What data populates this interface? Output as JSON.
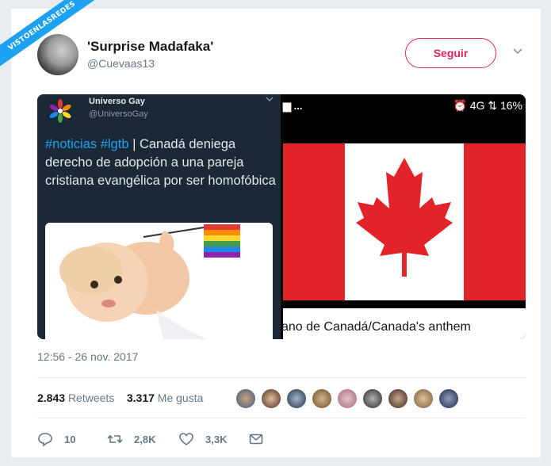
{
  "watermark": "VISTOENLASREDES",
  "tweet": {
    "display_name": "'Surprise Madafaka'",
    "handle": "@Cuevaas13",
    "follow_label": "Seguir",
    "timestamp": "12:56 - 26 nov. 2017",
    "retweets_count": "2.843",
    "retweets_label": "Retweets",
    "likes_count": "3.317",
    "likes_label": "Me gusta",
    "actions": {
      "replies": "10",
      "retweets": "2,8K",
      "likes": "3,3K"
    }
  },
  "embedded_left": {
    "account_name": "Universo Gay",
    "account_handle": "@UniversoGay",
    "hashtag1": "#noticias",
    "hashtag2": "#lgtb",
    "text": " | Canadá deniega derecho de adopción a una pareja cristiana evangélica por ser homofóbica"
  },
  "embedded_right": {
    "status_left": "▆ ...",
    "status_right": "⏰ 4G ⇅ 16%",
    "caption": "ano de Canadá/Canada's anthem"
  },
  "colors": {
    "accent": "#1da1f2",
    "follow": "#e0245e",
    "secondary_text": "#657786",
    "flag_red": "#e0242a"
  },
  "icons": [
    "reply-icon",
    "retweet-icon",
    "like-icon",
    "message-icon",
    "chevron-down-icon"
  ]
}
